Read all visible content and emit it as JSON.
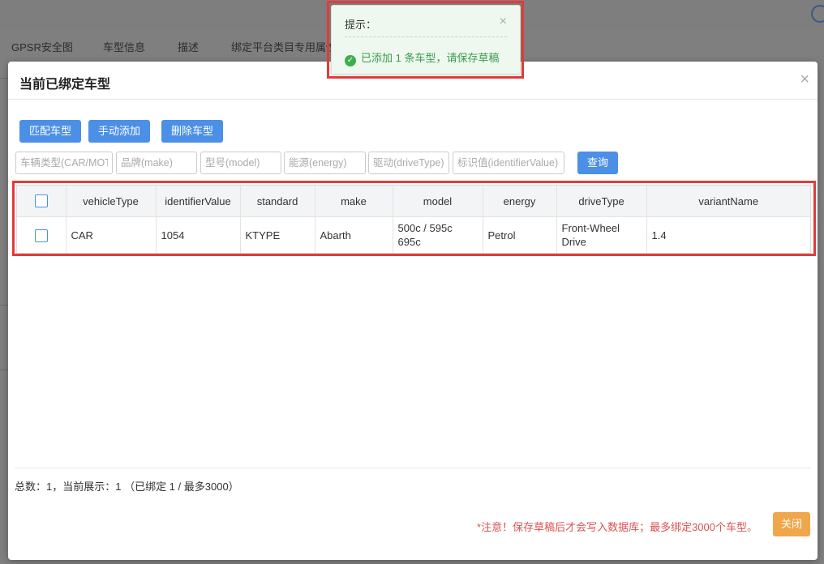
{
  "background": {
    "tabs": [
      "GPSR安全图",
      "车型信息",
      "描述",
      "绑定平台类目专用属性"
    ]
  },
  "modal": {
    "title": "当前已绑定车型",
    "close_icon": "×",
    "buttons": {
      "match": "匹配车型",
      "manual_add": "手动添加",
      "delete": "删除车型"
    },
    "filters": {
      "vehicle_type": "车辆类型(CAR/MOTO)",
      "make": "品牌(make)",
      "model": "型号(model)",
      "energy": "能源(energy)",
      "drive_type": "驱动(driveType)",
      "identifier": "标识值(identifierValue)"
    },
    "search_button": "查询",
    "table": {
      "columns": [
        "vehicleType",
        "identifierValue",
        "standard",
        "make",
        "model",
        "energy",
        "driveType",
        "variantName"
      ],
      "rows": [
        {
          "vehicleType": "CAR",
          "identifierValue": "1054",
          "standard": "KTYPE",
          "make": "Abarth",
          "model": "500c / 595c 695c",
          "energy": "Petrol",
          "driveType": "Front-Wheel Drive",
          "variantName": "1.4"
        }
      ]
    },
    "summary": "总数：1，当前展示：1 （已绑定 1 / 最多3000）",
    "note": "*注意！保存草稿后才会写入数据库；最多绑定3000个车型。",
    "close_button": "关闭"
  },
  "toast": {
    "title": "提示：",
    "close_icon": "×",
    "message": "已添加 1 条车型，请保存草稿",
    "icon": "check-circle-icon"
  },
  "colors": {
    "primary": "#4c8fe6",
    "warning_button": "#f0a64b",
    "success": "#3a9b4a",
    "danger_note": "#d9534f",
    "highlight": "#e23a3a"
  }
}
